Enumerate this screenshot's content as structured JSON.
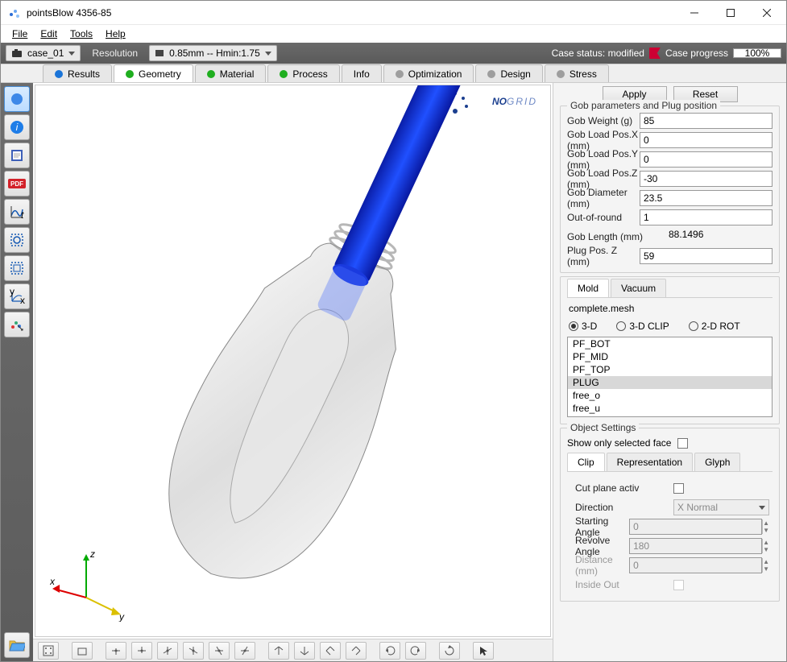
{
  "window": {
    "title": "pointsBlow 4356-85"
  },
  "menu": {
    "file": "File",
    "edit": "Edit",
    "tools": "Tools",
    "help": "Help"
  },
  "top_toolbar": {
    "case_name": "case_01",
    "resolution_label": "Resolution",
    "resolution_value": "0.85mm -- Hmin:1.75",
    "status_label": "Case status: modified",
    "progress_label": "Case progress",
    "progress_value": "100%"
  },
  "tabs": {
    "results": "Results",
    "geometry": "Geometry",
    "material": "Material",
    "process": "Process",
    "info": "Info",
    "optimization": "Optimization",
    "design": "Design",
    "stress": "Stress"
  },
  "panel": {
    "apply": "Apply",
    "reset": "Reset",
    "gob_group": "Gob parameters and Plug position",
    "fields": {
      "gob_weight_l": "Gob Weight (g)",
      "gob_weight_v": "85",
      "gob_load_x_l": "Gob Load Pos.X (mm)",
      "gob_load_x_v": "0",
      "gob_load_y_l": "Gob Load Pos.Y (mm)",
      "gob_load_y_v": "0",
      "gob_load_z_l": "Gob Load Pos.Z (mm)",
      "gob_load_z_v": "-30",
      "gob_dia_l": "Gob Diameter (mm)",
      "gob_dia_v": "23.5",
      "out_round_l": "Out-of-round",
      "out_round_v": "1",
      "gob_len_l": "Gob Length (mm)",
      "gob_len_v": "88.1496",
      "plug_z_l": "Plug Pos. Z (mm)",
      "plug_z_v": "59"
    },
    "mold_tabs": {
      "mold": "Mold",
      "vacuum": "Vacuum"
    },
    "mesh_file": "complete.mesh",
    "view_modes": {
      "threed": "3-D",
      "clip": "3-D CLIP",
      "rot": "2-D ROT"
    },
    "list": [
      "PF_BOT",
      "PF_MID",
      "PF_TOP",
      "PLUG",
      "free_o",
      "free_u"
    ],
    "obj_settings": "Object Settings",
    "show_face": "Show only selected face",
    "obj_tabs": {
      "clip": "Clip",
      "rep": "Representation",
      "glyph": "Glyph"
    },
    "clip": {
      "cut_plane": "Cut plane activ",
      "direction": "Direction",
      "direction_v": "X Normal",
      "start_ang": "Starting Angle",
      "start_ang_v": "0",
      "rev_ang": "Revolve Angle",
      "rev_ang_v": "180",
      "distance": "Distance (mm)",
      "distance_v": "0",
      "inside": "Inside Out"
    }
  },
  "axis": {
    "x": "x",
    "y": "y",
    "z": "z"
  },
  "logo": {
    "no": "NO",
    "grid": "GRID"
  },
  "left_icons": {
    "pdf": "PDF"
  }
}
